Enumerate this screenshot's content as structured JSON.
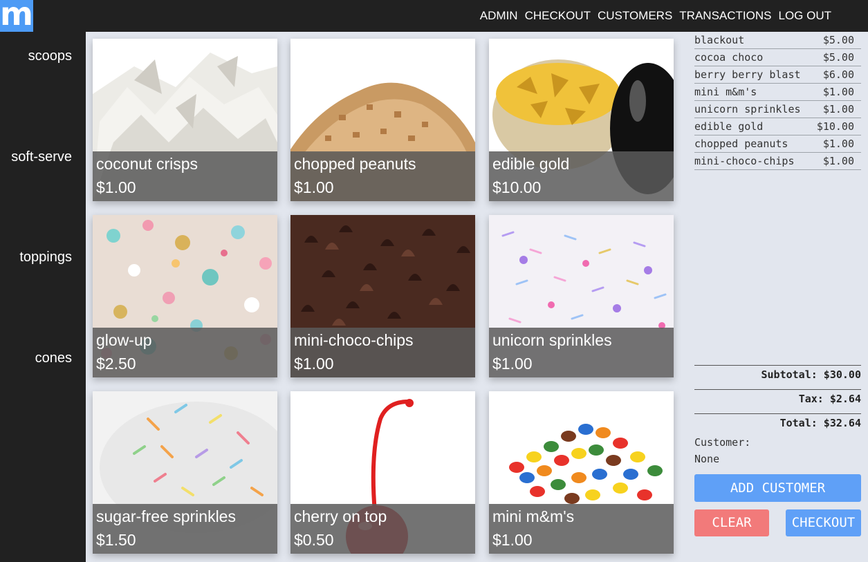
{
  "brand": {
    "logo": "m"
  },
  "nav": [
    "ADMIN",
    "CHECKOUT",
    "CUSTOMERS",
    "TRANSACTIONS",
    "LOG OUT"
  ],
  "sidebar": [
    "scoops",
    "soft-serve",
    "toppings",
    "cones"
  ],
  "products": [
    {
      "name": "coconut crisps",
      "price": "$1.00",
      "icon": "coconut-flakes"
    },
    {
      "name": "chopped peanuts",
      "price": "$1.00",
      "icon": "chopped-peanuts"
    },
    {
      "name": "edible gold",
      "price": "$10.00",
      "icon": "gold-flakes-jar"
    },
    {
      "name": "glow-up",
      "price": "$2.50",
      "icon": "pastel-sprinkles"
    },
    {
      "name": "mini-choco-chips",
      "price": "$1.00",
      "icon": "chocolate-chips"
    },
    {
      "name": "unicorn sprinkles",
      "price": "$1.00",
      "icon": "unicorn-sprinkles"
    },
    {
      "name": "sugar-free sprinkles",
      "price": "$1.50",
      "icon": "rainbow-sprinkles"
    },
    {
      "name": "cherry on top",
      "price": "$0.50",
      "icon": "maraschino-cherry"
    },
    {
      "name": "mini m&m's",
      "price": "$1.00",
      "icon": "candy-pile"
    }
  ],
  "cart": {
    "items": [
      {
        "name": "blackout",
        "price": "$5.00"
      },
      {
        "name": "cocoa choco",
        "price": "$5.00"
      },
      {
        "name": "berry berry blast",
        "price": "$6.00"
      },
      {
        "name": "mini m&m's",
        "price": "$1.00"
      },
      {
        "name": "unicorn sprinkles",
        "price": "$1.00"
      },
      {
        "name": "edible gold",
        "price": "$10.00"
      },
      {
        "name": "chopped peanuts",
        "price": "$1.00"
      },
      {
        "name": "mini-choco-chips",
        "price": "$1.00"
      }
    ],
    "subtotal": "Subtotal: $30.00",
    "tax": "Tax: $2.64",
    "total": "Total: $32.64",
    "customer_label": "Customer:",
    "customer_value": "None"
  },
  "buttons": {
    "add_customer": "ADD CUSTOMER",
    "clear": "CLEAR",
    "checkout": "CHECKOUT"
  },
  "colors": {
    "primary": "#5fa0f7",
    "danger": "#f27a7a",
    "dark": "#212121",
    "background": "#e2e6ee"
  }
}
